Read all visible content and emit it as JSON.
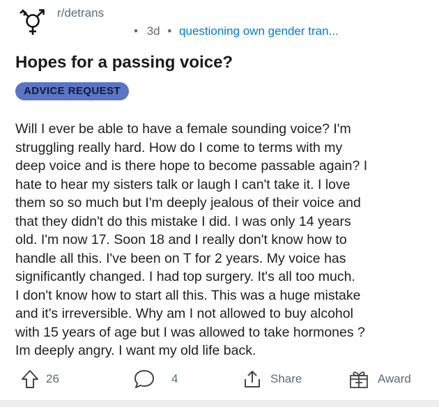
{
  "post": {
    "subreddit": "r/detrans",
    "age": "3d",
    "separator": "•",
    "flair_text": "questioning own gender tran...",
    "title": "Hopes for a passing voice?",
    "tag": "ADVICE REQUEST",
    "body_lines": [
      "Will I ever be able to have a female sounding voice? I'm",
      "struggling really hard. How do I come to terms with my",
      "deep voice and is there hope to become passable again? I",
      "hate to hear my sisters talk or laugh I can't take it. I love",
      "them so so much but I'm deeply jealous of their voice and",
      "that they didn't do this mistake I did. I was only 14 years",
      "old. I'm now 17. Soon 18 and I really don't know how to",
      "handle all this. I've been on T for 2 years. My voice has",
      "significantly changed. I had top surgery. It's all too much.",
      "I don't know how to start all this. This was a huge mistake",
      "and it's irreversible. Why am I not allowed to buy alcohol",
      "with 15 years of age but I was allowed to take hormones ?",
      "Im deeply angry. I want my old life back."
    ]
  },
  "actions": {
    "upvotes": "26",
    "comments": "4",
    "share_label": "Share",
    "award_label": "Award"
  },
  "icons": {
    "subreddit_avatar": "gender-symbol-icon",
    "upvote": "upvote-arrow-icon",
    "comment": "comment-bubble-icon",
    "share": "share-icon",
    "award": "gift-box-icon"
  },
  "colors": {
    "meta_text": "#576f76",
    "flair_link": "#0079d3",
    "tag_background": "#5b74c4",
    "tag_text": "#101a3a"
  }
}
